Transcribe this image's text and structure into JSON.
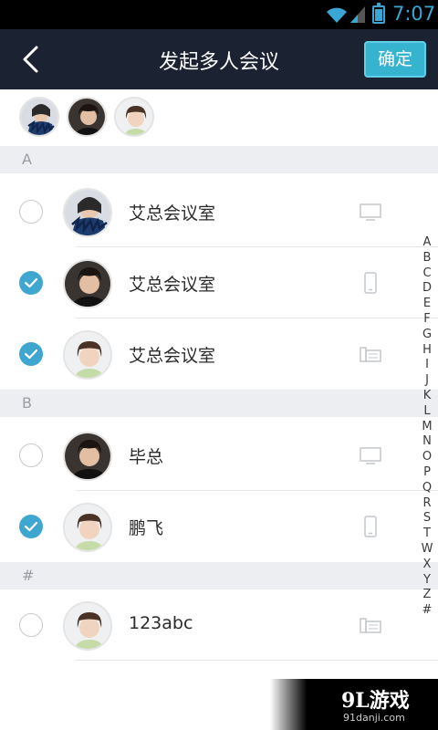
{
  "status_bar": {
    "time": "7:07"
  },
  "header": {
    "title": "发起多人会议",
    "confirm_label": "确定"
  },
  "selected_avatars": [
    "avatar-woman-fur",
    "avatar-man",
    "avatar-child"
  ],
  "sections": [
    {
      "letter": "A"
    },
    {
      "letter": "B"
    },
    {
      "letter": "#"
    }
  ],
  "contacts": [
    {
      "name": "艾总会议室",
      "checked": false,
      "avatar": "avatar-woman-fur",
      "device": "monitor-icon"
    },
    {
      "name": "艾总会议室",
      "checked": true,
      "avatar": "avatar-man",
      "device": "phone-icon"
    },
    {
      "name": "艾总会议室",
      "checked": true,
      "avatar": "avatar-child",
      "device": "desk-phone-icon"
    },
    {
      "name": "毕总",
      "checked": false,
      "avatar": "avatar-man",
      "device": "monitor-icon"
    },
    {
      "name": "鹏飞",
      "checked": true,
      "avatar": "avatar-child",
      "device": "phone-icon"
    },
    {
      "name": "123abc",
      "checked": false,
      "avatar": "avatar-child",
      "device": "desk-phone-icon"
    }
  ],
  "index_letters": [
    "A",
    "B",
    "C",
    "D",
    "E",
    "F",
    "G",
    "H",
    "I",
    "J",
    "K",
    "L",
    "M",
    "N",
    "O",
    "P",
    "Q",
    "R",
    "S",
    "T",
    "W",
    "X",
    "Y",
    "Z",
    "#"
  ],
  "watermark": {
    "logo": "9L游戏",
    "url": "91danji.com"
  },
  "colors": {
    "header_bg": "#1b2333",
    "accent": "#36b3cf",
    "check": "#3fa7cf",
    "section_bg": "#eceef2"
  }
}
